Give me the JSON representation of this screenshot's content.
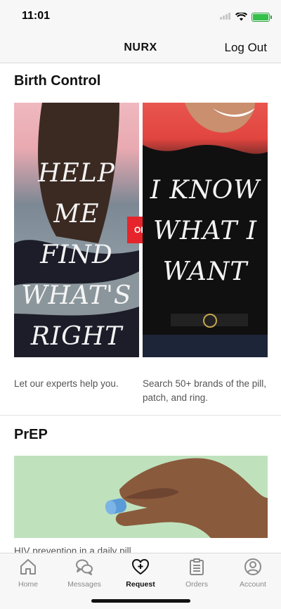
{
  "status": {
    "time": "11:01"
  },
  "nav": {
    "title": "NURX",
    "logout_label": "Log Out"
  },
  "birth_control": {
    "title": "Birth Control",
    "left_tile": {
      "lines": [
        "HELP",
        "ME FIND",
        "WHAT'S",
        "RIGHT"
      ],
      "caption": "Let our experts help you."
    },
    "or_label": "OR",
    "right_tile": {
      "lines": [
        "I KNOW",
        "WHAT I",
        "WANT"
      ],
      "caption": "Search 50+ brands of the pill, patch, and ring."
    }
  },
  "prep": {
    "title": "PrEP",
    "caption": "HIV prevention in a daily pill."
  },
  "tabs": [
    {
      "label": "Home",
      "icon": "home-icon"
    },
    {
      "label": "Messages",
      "icon": "messages-icon"
    },
    {
      "label": "Request",
      "icon": "heart-plus-icon",
      "active": true
    },
    {
      "label": "Orders",
      "icon": "clipboard-icon"
    },
    {
      "label": "Account",
      "icon": "account-icon"
    }
  ],
  "colors": {
    "or_badge": "#e5252b",
    "prep_background": "#bfe2bd",
    "battery": "#35c04a"
  }
}
